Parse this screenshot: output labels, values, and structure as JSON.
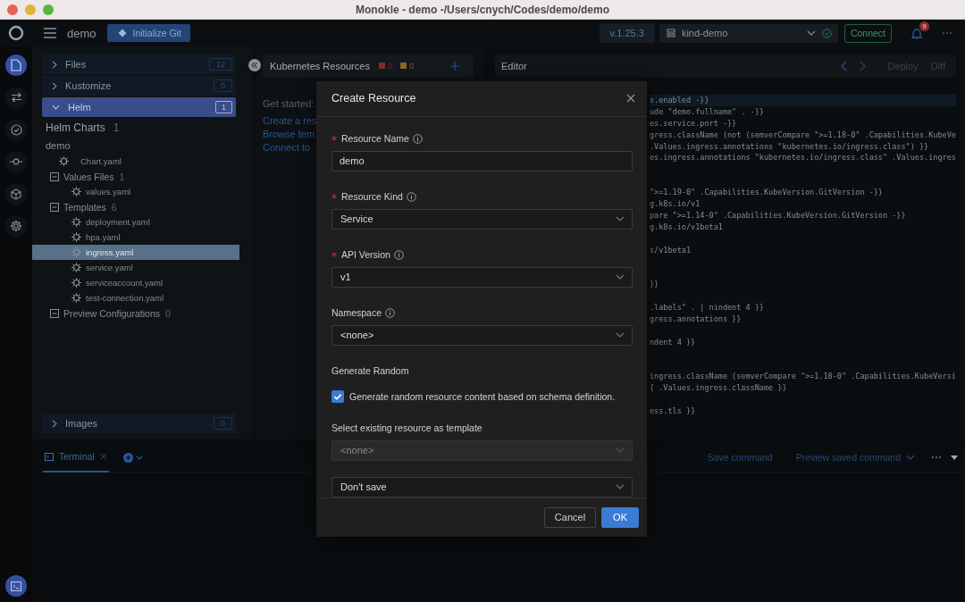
{
  "window": {
    "title": "Monokle - demo -/Users/cnych/Codes/demo/demo"
  },
  "header": {
    "project": "demo",
    "git_button": "Initialize Git",
    "version": "v.1.25.3",
    "cluster": "kind-demo",
    "connect_button": "Connect",
    "notification_count": "9"
  },
  "rail": [
    {
      "kind": "files",
      "selected": true
    },
    {
      "kind": "compare",
      "selected": false
    },
    {
      "kind": "validation",
      "selected": false
    },
    {
      "kind": "git",
      "selected": false
    },
    {
      "kind": "plugins",
      "selected": false
    },
    {
      "kind": "settings",
      "selected": false
    }
  ],
  "rail_bottom": [
    {
      "kind": "terminal",
      "selected": true
    }
  ],
  "explorer": {
    "sections": [
      {
        "label": "Files",
        "count": "12",
        "expanded": false,
        "selected": false
      },
      {
        "label": "Kustomize",
        "count": "0",
        "expanded": false,
        "selected": false
      },
      {
        "label": "Helm",
        "count": "1",
        "expanded": true,
        "selected": true
      }
    ],
    "helm_title": "Helm Charts",
    "helm_count": "1",
    "chart": "demo",
    "tree": [
      {
        "kind": "file",
        "label": "Chart.yaml",
        "selected": false
      },
      {
        "kind": "group",
        "label": "Values Files",
        "count": "1",
        "expanded": true,
        "children": [
          {
            "kind": "file",
            "label": "values.yaml",
            "selected": false
          }
        ]
      },
      {
        "kind": "group",
        "label": "Templates",
        "count": "6",
        "expanded": true,
        "children": [
          {
            "kind": "file",
            "label": "deployment.yaml",
            "selected": false
          },
          {
            "kind": "file",
            "label": "hpa.yaml",
            "selected": false
          },
          {
            "kind": "file",
            "label": "ingress.yaml",
            "selected": true
          },
          {
            "kind": "file",
            "label": "service.yaml",
            "selected": false
          },
          {
            "kind": "file",
            "label": "serviceaccount.yaml",
            "selected": false
          },
          {
            "kind": "file",
            "label": "test-connection.yaml",
            "selected": false
          }
        ]
      },
      {
        "kind": "group",
        "label": "Preview Configurations",
        "count": "0",
        "expanded": true
      }
    ],
    "footer_sections": [
      {
        "label": "Images",
        "count": "0",
        "expanded": false,
        "selected": false
      }
    ]
  },
  "resources": {
    "title": "Kubernetes Resources",
    "error_count": "0",
    "warning_count": "0",
    "intro": "Get started:",
    "links": [
      "Create a res",
      "Browse tem",
      "Connect to"
    ]
  },
  "editor": {
    "title": "Editor",
    "actions": [
      "Deploy",
      "Diff"
    ],
    "lines": [
      {
        "kind": "code",
        "text": "s.enabled -}}"
      },
      {
        "kind": "code",
        "text": "ude \"demo.fullname\" . -}}"
      },
      {
        "kind": "code",
        "text": "es.service.port -}}"
      },
      {
        "kind": "code",
        "text": "gress.className (not (semverCompare \">=1.18-0\" .Capabilities.KubeVe"
      },
      {
        "kind": "code",
        "text": ".Values.ingress.annotations \"kubernetes.io/ingress.class\") }}"
      },
      {
        "kind": "code",
        "text": "es.ingress.annotations \"kubernetes.io/ingress.class\" .Values.ingres"
      },
      {
        "kind": "blank"
      },
      {
        "kind": "blank"
      },
      {
        "kind": "code",
        "text": "\">=1.19-0\" .Capabilities.KubeVersion.GitVersion -}}"
      },
      {
        "kind": "code",
        "text": "g.k8s.io/v1"
      },
      {
        "kind": "code",
        "text": "pare \">=1.14-0\" .Capabilities.KubeVersion.GitVersion -}}"
      },
      {
        "kind": "code",
        "text": "g.k8s.io/v1beta1"
      },
      {
        "kind": "blank"
      },
      {
        "kind": "code",
        "text": "s/v1beta1"
      },
      {
        "kind": "blank"
      },
      {
        "kind": "blank"
      },
      {
        "kind": "code",
        "text": "}}"
      },
      {
        "kind": "blank"
      },
      {
        "kind": "code",
        "text": ".labels\" . | nindent 4 }}"
      },
      {
        "kind": "code",
        "text": "gress.annotations }}"
      },
      {
        "kind": "blank"
      },
      {
        "kind": "code",
        "text": "ndent 4 }}"
      },
      {
        "kind": "blank"
      },
      {
        "kind": "blank"
      },
      {
        "kind": "code",
        "text": "ingress.className (semverCompare \">=1.18-0\" .Capabilities.KubeVersi"
      },
      {
        "kind": "code",
        "text": "{ .Values.ingress.className }}"
      },
      {
        "kind": "blank"
      },
      {
        "kind": "code",
        "text": "ess.tls }}"
      }
    ]
  },
  "dialog": {
    "title": "Create Resource",
    "fields": [
      {
        "kind": "input",
        "label": "Resource Name",
        "required": true,
        "info": true,
        "value": "demo"
      },
      {
        "kind": "select",
        "label": "Resource Kind",
        "required": true,
        "info": true,
        "value": "Service",
        "disabled": false
      },
      {
        "kind": "select",
        "label": "API Version",
        "required": true,
        "info": true,
        "value": "v1",
        "disabled": false
      },
      {
        "kind": "select",
        "label": "Namespace",
        "required": false,
        "info": true,
        "value": "<none>",
        "disabled": false
      },
      {
        "kind": "checkbox",
        "label": "Generate Random",
        "option": "Generate random resource content based on schema definition.",
        "checked": true
      },
      {
        "kind": "select",
        "label": "Select existing resource as template",
        "required": false,
        "info": false,
        "value": "<none>",
        "disabled": true
      },
      {
        "kind": "select",
        "value": "Don't save",
        "disabled": false
      }
    ],
    "buttons": [
      {
        "label": "Cancel",
        "kind": "secondary"
      },
      {
        "label": "OK",
        "kind": "primary"
      }
    ]
  },
  "terminal": {
    "tabs": [
      {
        "label": "Terminal",
        "selected": true
      }
    ],
    "actions": [
      "Save command",
      "Preview saved command"
    ]
  }
}
